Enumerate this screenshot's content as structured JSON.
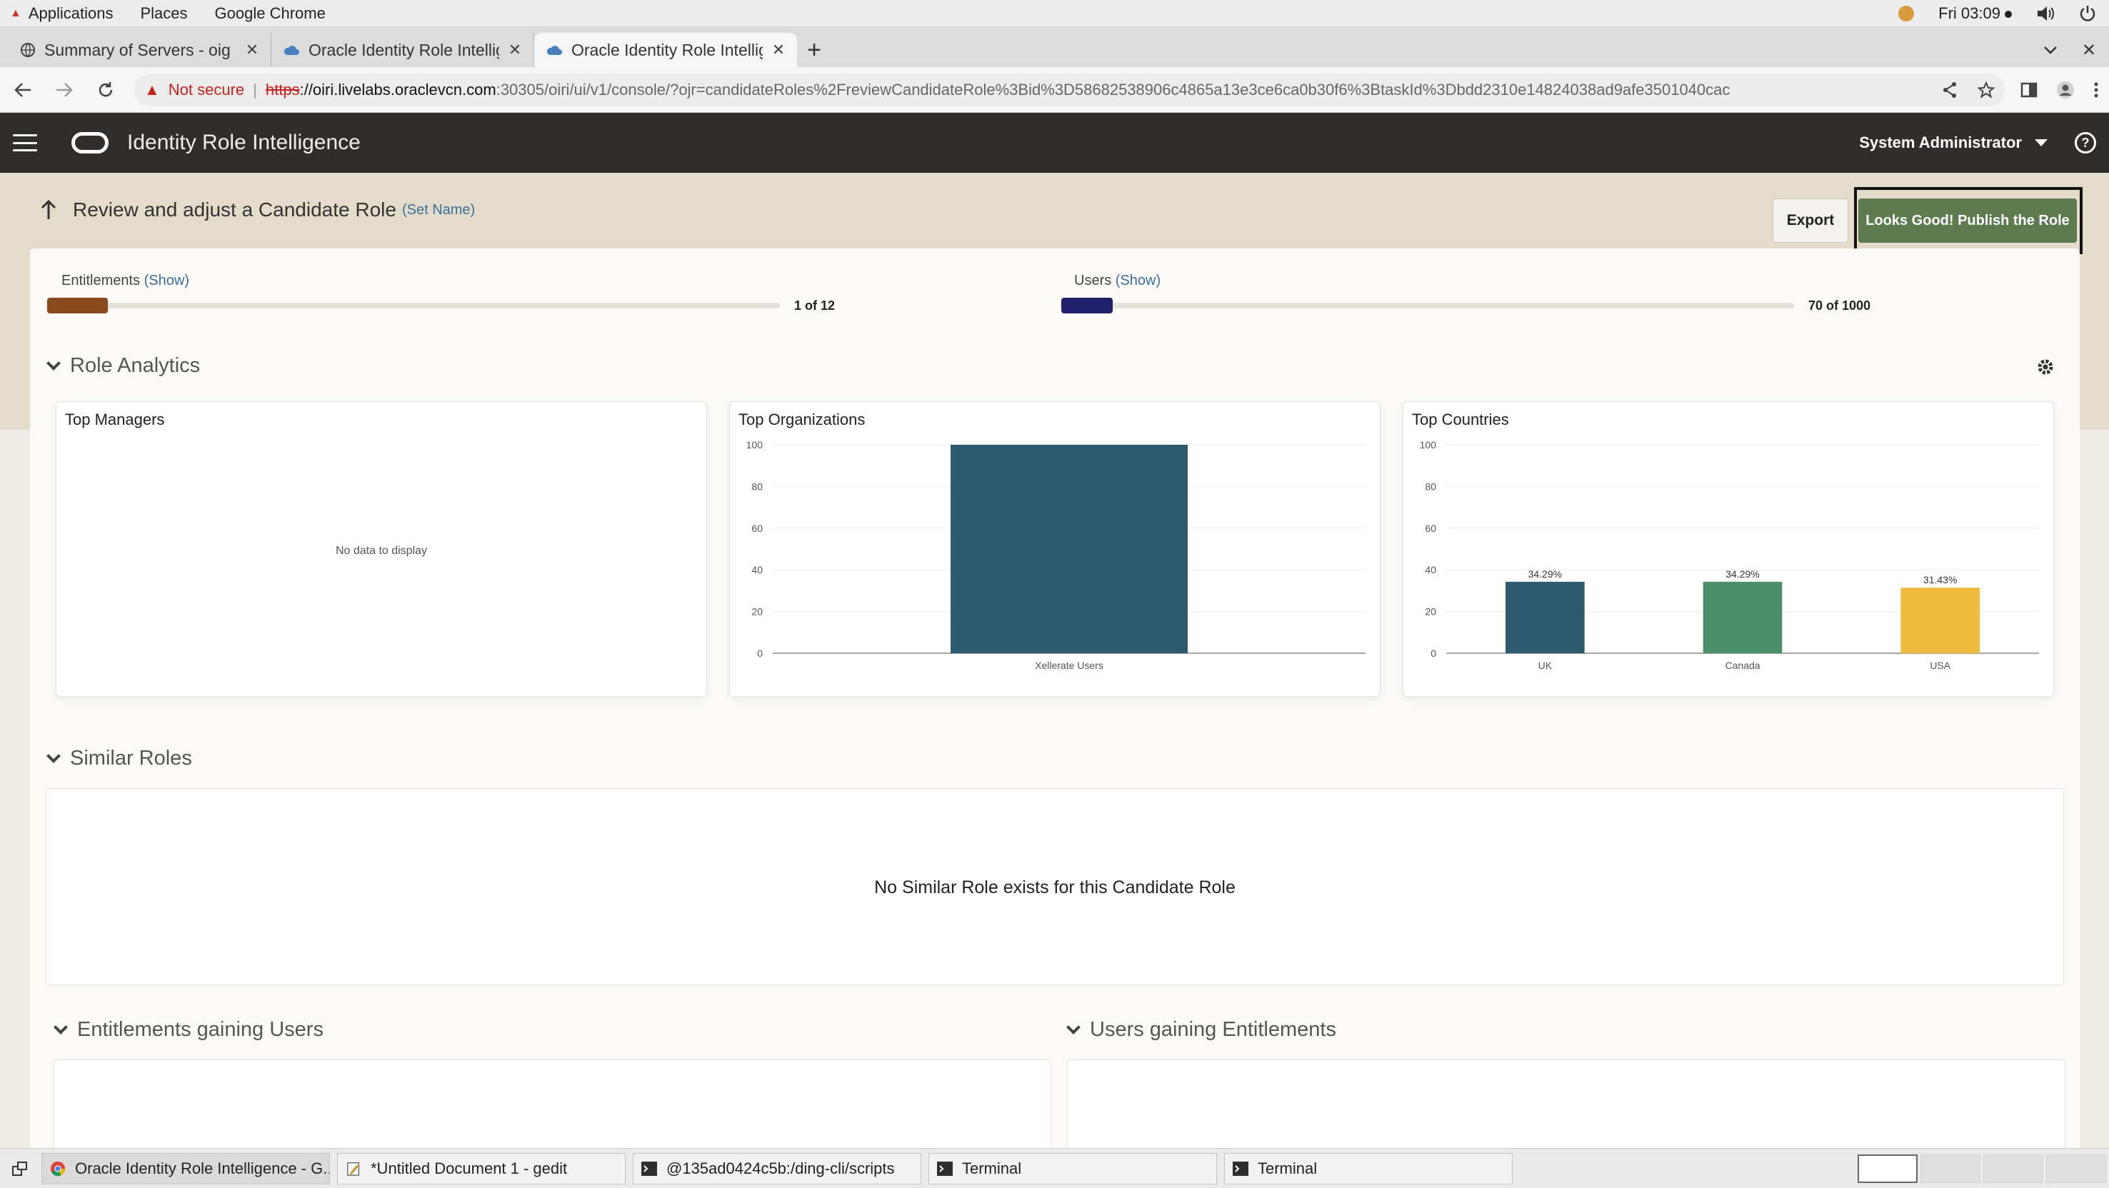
{
  "os": {
    "applications": "Applications",
    "places": "Places",
    "browser": "Google Chrome",
    "clock": "Fri 03:09"
  },
  "browser": {
    "tabs": [
      {
        "title": "Summary of Servers - oig",
        "icon": "globe-icon"
      },
      {
        "title": "Oracle Identity Role Intellig",
        "icon": "cloud-icon"
      },
      {
        "title": "Oracle Identity Role Intellig",
        "icon": "cloud-icon"
      }
    ],
    "address": {
      "warning": "Not secure",
      "separator": "|",
      "scheme": "https",
      "host": "://oiri.livelabs.oraclevcn.com",
      "path": ":30305/oiri/ui/v1/console/?ojr=candidateRoles%2FreviewCandidateRole%3Bid%3D58682538906c4865a13e3ce6ca0b30f6%3BtaskId%3Dbdd2310e14824038ad9afe3501040cac"
    }
  },
  "app": {
    "title": "Identity Role Intelligence",
    "user": "System Administrator",
    "header_color": "#312d2a"
  },
  "page": {
    "title": "Review and adjust a Candidate Role",
    "set_name": "(Set Name)",
    "export": "Export",
    "publish": "Looks Good! Publish the Role"
  },
  "meters": {
    "entitlements": {
      "label": "Entitlements",
      "show": "(Show)",
      "count": "1 of 12",
      "fraction": 0.0833,
      "color": "#8b4a1e"
    },
    "users": {
      "label": "Users",
      "show": "(Show)",
      "count": "70 of 1000",
      "fraction": 0.07,
      "color": "#1f1f6b"
    }
  },
  "sections": {
    "role_analytics": "Role Analytics",
    "similar_roles": "Similar Roles",
    "similar_empty": "No Similar Role exists for this Candidate Role",
    "entitlements_gaining": "Entitlements gaining Users",
    "users_gaining": "Users gaining Entitlements"
  },
  "cards": {
    "managers": {
      "title": "Top Managers",
      "empty": "No data to display"
    },
    "organizations": {
      "title": "Top Organizations"
    },
    "countries": {
      "title": "Top Countries"
    }
  },
  "chart_data": [
    {
      "type": "bar",
      "title": "Top Organizations",
      "categories": [
        "Xellerate Users"
      ],
      "values": [
        100
      ],
      "ylim": [
        0,
        100
      ],
      "yticks": [
        0,
        20,
        40,
        60,
        80,
        100
      ],
      "colors": [
        "#2c5a6e"
      ],
      "grid": true
    },
    {
      "type": "bar",
      "title": "Top Countries",
      "categories": [
        "UK",
        "Canada",
        "USA"
      ],
      "values": [
        34.29,
        34.29,
        31.43
      ],
      "labels": [
        "34.29%",
        "34.29%",
        "31.43%"
      ],
      "ylim": [
        0,
        100
      ],
      "yticks": [
        0,
        20,
        40,
        60,
        80,
        100
      ],
      "colors": [
        "#2c5a6e",
        "#4a8f68",
        "#efbb3c"
      ],
      "grid": true
    }
  ],
  "taskbar": {
    "items": [
      {
        "label": "Oracle Identity Role Intelligence - G...",
        "icon": "chrome-icon"
      },
      {
        "label": "*Untitled Document 1 - gedit",
        "icon": "gedit-icon"
      },
      {
        "label": "@135ad0424c5b:/ding-cli/scripts",
        "icon": "terminal-icon"
      },
      {
        "label": "Terminal",
        "icon": "terminal-icon"
      },
      {
        "label": "Terminal",
        "icon": "terminal-icon"
      }
    ]
  }
}
